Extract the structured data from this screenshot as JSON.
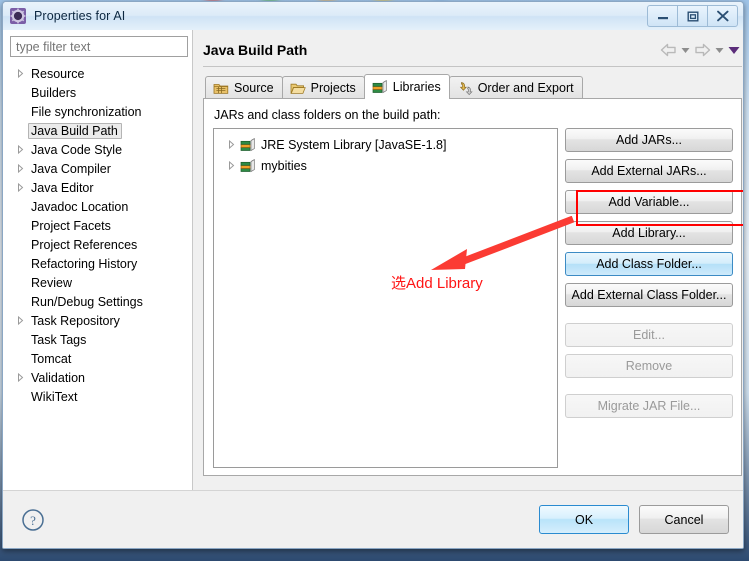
{
  "window": {
    "title": "Properties for AI",
    "icon": "properties-gear-icon",
    "controls": [
      {
        "name": "minimize",
        "glyph": "minimize-icon"
      },
      {
        "name": "maximize",
        "glyph": "maximize-icon"
      },
      {
        "name": "close",
        "glyph": "close-icon"
      }
    ]
  },
  "sidebar": {
    "filter": {
      "value": "",
      "placeholder": "type filter text"
    },
    "items": [
      {
        "label": "Resource",
        "expandable": true,
        "selected": false
      },
      {
        "label": "Builders",
        "expandable": false,
        "selected": false
      },
      {
        "label": "File synchronization",
        "expandable": false,
        "selected": false
      },
      {
        "label": "Java Build Path",
        "expandable": false,
        "selected": true
      },
      {
        "label": "Java Code Style",
        "expandable": true,
        "selected": false
      },
      {
        "label": "Java Compiler",
        "expandable": true,
        "selected": false
      },
      {
        "label": "Java Editor",
        "expandable": true,
        "selected": false
      },
      {
        "label": "Javadoc Location",
        "expandable": false,
        "selected": false
      },
      {
        "label": "Project Facets",
        "expandable": false,
        "selected": false
      },
      {
        "label": "Project References",
        "expandable": false,
        "selected": false
      },
      {
        "label": "Refactoring History",
        "expandable": false,
        "selected": false
      },
      {
        "label": "Review",
        "expandable": false,
        "selected": false
      },
      {
        "label": "Run/Debug Settings",
        "expandable": false,
        "selected": false
      },
      {
        "label": "Task Repository",
        "expandable": true,
        "selected": false
      },
      {
        "label": "Task Tags",
        "expandable": false,
        "selected": false
      },
      {
        "label": "Tomcat",
        "expandable": false,
        "selected": false
      },
      {
        "label": "Validation",
        "expandable": true,
        "selected": false
      },
      {
        "label": "WikiText",
        "expandable": false,
        "selected": false
      }
    ]
  },
  "page": {
    "title": "Java Build Path",
    "nav": [
      {
        "name": "back-arrow-icon"
      },
      {
        "name": "back-dropdown-icon"
      },
      {
        "name": "forward-arrow-icon"
      },
      {
        "name": "forward-dropdown-icon"
      },
      {
        "name": "menu-dropdown-icon"
      }
    ]
  },
  "tabs": [
    {
      "label": "Source",
      "icon": "source-package-icon",
      "active": false
    },
    {
      "label": "Projects",
      "icon": "open-folder-icon",
      "active": false
    },
    {
      "label": "Libraries",
      "icon": "library-books-icon",
      "active": true
    },
    {
      "label": "Order and Export",
      "icon": "order-export-icon",
      "active": false
    }
  ],
  "libraries_tab": {
    "description": "JARs and class folders on the build path:",
    "entries": [
      {
        "label": "JRE System Library [JavaSE-1.8]",
        "icon": "library-books-icon",
        "expandable": true
      },
      {
        "label": "mybities",
        "icon": "library-books-icon",
        "expandable": true
      }
    ],
    "buttons": [
      {
        "label": "Add JARs...",
        "state": "normal",
        "gap": false
      },
      {
        "label": "Add External JARs...",
        "state": "normal",
        "gap": false
      },
      {
        "label": "Add Variable...",
        "state": "normal",
        "gap": false
      },
      {
        "label": "Add Library...",
        "state": "normal",
        "gap": false
      },
      {
        "label": "Add Class Folder...",
        "state": "hover",
        "gap": false
      },
      {
        "label": "Add External Class Folder...",
        "state": "normal",
        "gap": false
      },
      {
        "label": "Edit...",
        "state": "disabled",
        "gap": true
      },
      {
        "label": "Remove",
        "state": "disabled",
        "gap": false
      },
      {
        "label": "Migrate JAR File...",
        "state": "disabled",
        "gap": true
      }
    ]
  },
  "annotation": {
    "text": "选Add Library",
    "color": "#ff1414",
    "highlight_target": "Add Library..."
  },
  "footer": {
    "help": "help-question-icon",
    "ok_label": "OK",
    "cancel_label": "Cancel"
  }
}
